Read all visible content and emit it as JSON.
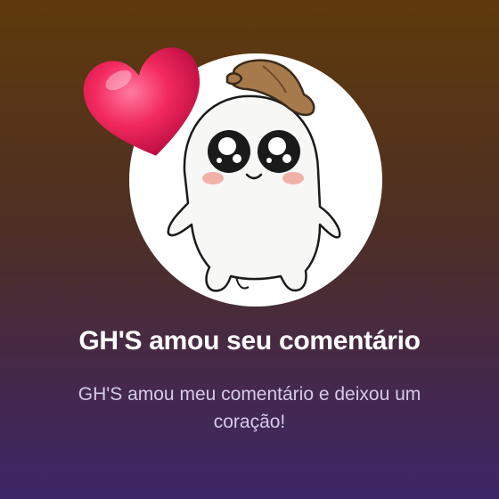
{
  "notification": {
    "icons": {
      "badge": "heart-icon",
      "avatar": "ghost-character-avatar"
    },
    "title": "GH'S amou seu comentário",
    "message": "GH'S amou meu comentário e deixou um coração!"
  },
  "colors": {
    "background_top": "#5f3a0b",
    "background_bottom": "#3e2768",
    "title_text": "#ffffff",
    "message_text": "#d6cbe6",
    "heart": "#f2295f",
    "hat": "#a77a4c"
  }
}
